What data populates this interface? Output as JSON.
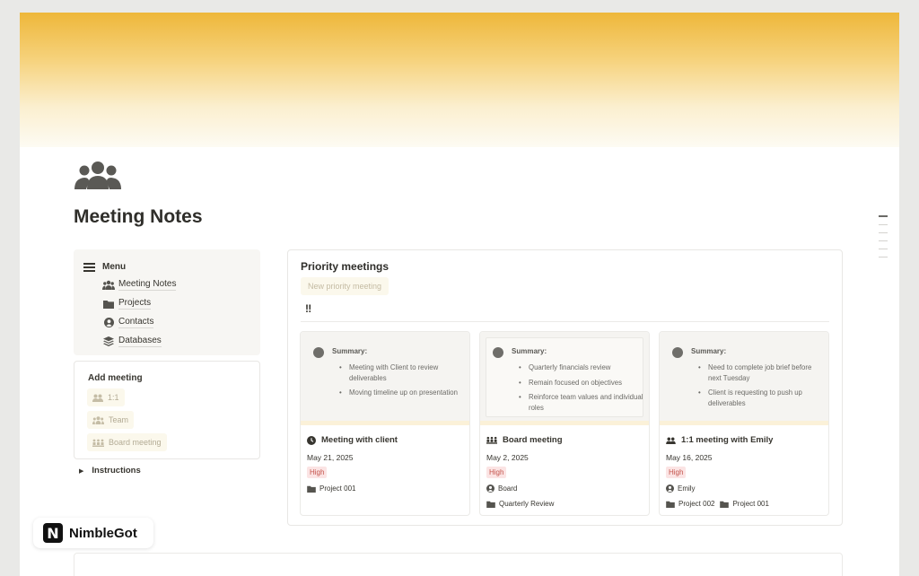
{
  "page": {
    "title": "Meeting Notes",
    "icon": "people-group-icon"
  },
  "menu": {
    "heading": "Menu",
    "items": [
      {
        "label": "Meeting Notes",
        "icon": "people-icon"
      },
      {
        "label": "Projects",
        "icon": "folder-icon"
      },
      {
        "label": "Contacts",
        "icon": "person-circle-icon"
      },
      {
        "label": "Databases",
        "icon": "layers-icon"
      }
    ]
  },
  "add_meeting": {
    "heading": "Add meeting",
    "buttons": [
      {
        "label": "1:1",
        "icon": "two-people-icon"
      },
      {
        "label": "Team",
        "icon": "group-icon"
      },
      {
        "label": "Board meeting",
        "icon": "board-icon"
      }
    ]
  },
  "instructions": {
    "label": "Instructions"
  },
  "priority": {
    "title": "Priority meetings",
    "new_button": "New priority meeting",
    "marker": "‼",
    "cards": [
      {
        "summary_label": "Summary:",
        "bullets": [
          "Meeting with Client to review deliverables",
          "Moving timeline up on presentation"
        ],
        "name": "Meeting with client",
        "name_icon": "clock-icon",
        "date": "May 21, 2025",
        "priority": "High",
        "props": [
          {
            "label": "Project 001",
            "icon": "folder-icon"
          }
        ]
      },
      {
        "summary_label": "Summary:",
        "bullets": [
          "Quarterly financials review",
          "Remain focused on objectives",
          "Reinforce team values and individual roles"
        ],
        "name": "Board meeting",
        "name_icon": "board-icon",
        "date": "May 2, 2025",
        "priority": "High",
        "props": [
          {
            "label": "Board",
            "icon": "person-circle-icon"
          },
          {
            "label": "Quarterly Review",
            "icon": "folder-icon"
          }
        ]
      },
      {
        "summary_label": "Summary:",
        "bullets": [
          "Need to complete job brief before next Tuesday",
          "Client is requesting to push up deliverables"
        ],
        "name": "1:1 meeting with Emily",
        "name_icon": "two-people-icon",
        "date": "May 16, 2025",
        "priority": "High",
        "props": [
          {
            "label": "Emily",
            "icon": "person-circle-icon"
          }
        ],
        "projects": [
          "Project 002",
          "Project 001"
        ]
      }
    ]
  },
  "brand": {
    "logo_letter": "N",
    "name": "NimbleGot"
  },
  "colors": {
    "accent": "#eeb73a",
    "badge_bg": "#fbe4e4",
    "badge_text": "#c4554d"
  }
}
